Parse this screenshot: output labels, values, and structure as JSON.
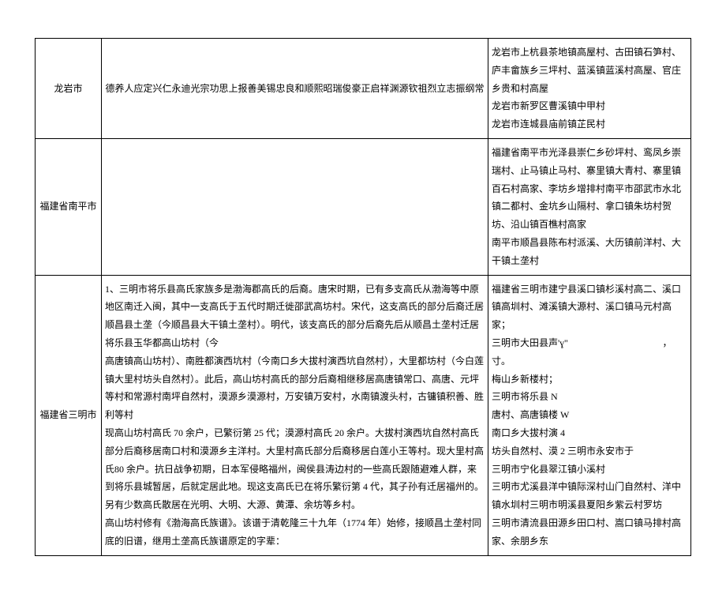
{
  "rows": [
    {
      "region": "龙岩市",
      "desc": "德养人应定兴仁永迪光宗功思上报善美锡忠良和顺熙昭瑞俊豪正启祥渊源钦祖烈立志振纲常",
      "places": "龙岩市上杭县茶地镇高屋村、古田镇石笋村、庐丰畲族乡三坪村、蓝溪镇蓝溪村高屋、官庄乡贵和村高屋\n龙岩市新罗区曹溪镇中甲村\n龙岩市连城县庙前镇芷民村"
    },
    {
      "region": "福建省南平市",
      "desc": "",
      "places": "福建省南平市光泽县崇仁乡砂坪村、鸾凤乡崇瑞村、止马镇止马村、寨里镇大青村、寨里镇百石村高家、李坊乡增排村南平市邵武市水北镇二都村、金坑乡山隔村、拿口镇朱坊村贺坊、沿山镇百樵村高家\n南平市顺昌县陈布村派溪、大历镇前洋村、大干镇土垄村"
    },
    {
      "region": "福建省三明市",
      "desc": "1、三明市将乐县高氏家族多是渤海郡高氏的后裔。唐宋时期，已有多支高氏从渤海等中原地区南迁入闽，其中一支高氏于五代时期迁徙邵武高坊村。宋代，这支高氏的部分后裔迁居顺昌县土垄（今顺昌县大干镇土垄村）。明代，该支高氏的部分后裔先后从顺昌土垄村迁居将乐县玉华都高山坊村（今\n高唐镇高山坊村）、南胜都演西坑村（今南口乡大拔村演西坑自然村），大里都坊村（今白莲镇大里村坊头自然村）。此后，高山坊村高氏的部分后裔相继移居高唐镇常口、高唐、元坪等村和常源村南坪自然村，漠源乡漠源村，万安镇万安村，水南镇渡头村，古镛镇积善、胜利等村\n现高山坊村高氏 70 余户，已繁衍第 25 代；漠源村高氏 20 余户。大拔村演西坑自然村高氏部分后裔移居南口村和漠源乡主洋村。大里村高氏部分后裔移居白莲小王等村。现大里村高氏80 余户。抗日战争初期，日本军侵略福州，闽侯县涛边村的一些高氏跟随避难人群，来到将乐县城暂居，后就定居此地。现这支高氏已在将乐繁衍第 4 代，其子孙有迁居福州的。另有少数高氏散居在光明、大明、大源、黄潭、余坊等乡村。\n高山坊村修有《渤海高氏族谱》。该谱于清乾隆三十九年（1774 年）始修，接顺昌土垄村同底的旧谱，继用土垄高氏族谱原定的字辈：",
      "places": "福建省三明市建宁县溪口镇杉溪村高二、溪口镇高圳村、滩溪镇大源村、溪口镇马元村高家；\n三明市大田县声'ɣ''　　　　　　　　　　，寸。\n梅山乡新楼村；\n三明市将乐县 N　　　　　　　　　　　　　　　唐村、高唐镇楼 W　　　　　　　　　　　　　　南口乡大拔村演 4　　　　　　　　　　　　　　坊头自然村、漠 2 三明市永安市于\n三明市宁化县翠江镇小溪村\n三明市尤溪县洋中镇际深村山门自然村、洋中镇水圳村三明市明溪县夏阳乡紫云村罗坊\n三明市清流县田源乡田口村、嵩口镇马排村高家、余朋乡东"
    }
  ]
}
